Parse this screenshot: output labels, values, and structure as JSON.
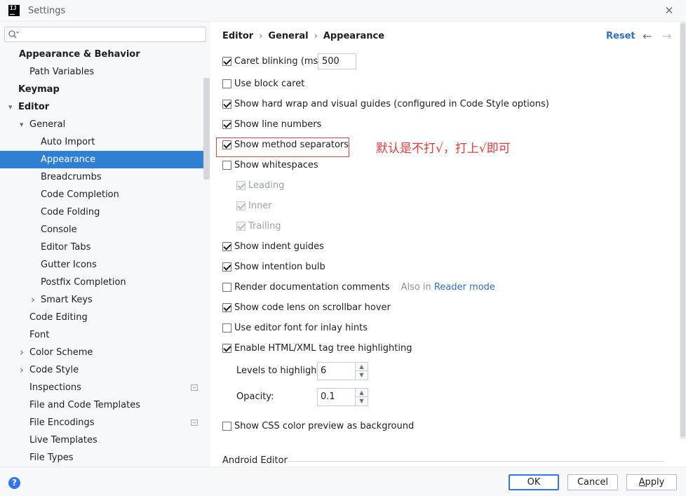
{
  "window": {
    "title": "Settings",
    "logo_text": "IJ"
  },
  "search": {
    "placeholder": "",
    "value": ""
  },
  "tree": [
    {
      "label": "Appearance & Behavior",
      "bold": true,
      "arrow": ""
    },
    {
      "label": "Path Variables",
      "bold": false,
      "arrow": ""
    },
    {
      "label": "Keymap",
      "bold": true,
      "arrow": ""
    },
    {
      "label": "Editor",
      "bold": true,
      "arrow": "▾"
    },
    {
      "label": "General",
      "bold": false,
      "arrow": "▾"
    },
    {
      "label": "Auto Import",
      "bold": false,
      "arrow": ""
    },
    {
      "label": "Appearance",
      "bold": false,
      "arrow": "",
      "selected": true
    },
    {
      "label": "Breadcrumbs",
      "bold": false,
      "arrow": ""
    },
    {
      "label": "Code Completion",
      "bold": false,
      "arrow": ""
    },
    {
      "label": "Code Folding",
      "bold": false,
      "arrow": ""
    },
    {
      "label": "Console",
      "bold": false,
      "arrow": ""
    },
    {
      "label": "Editor Tabs",
      "bold": false,
      "arrow": ""
    },
    {
      "label": "Gutter Icons",
      "bold": false,
      "arrow": ""
    },
    {
      "label": "Postfix Completion",
      "bold": false,
      "arrow": ""
    },
    {
      "label": "Smart Keys",
      "bold": false,
      "arrow": "›"
    },
    {
      "label": "Code Editing",
      "bold": false,
      "arrow": ""
    },
    {
      "label": "Font",
      "bold": false,
      "arrow": ""
    },
    {
      "label": "Color Scheme",
      "bold": false,
      "arrow": "›"
    },
    {
      "label": "Code Style",
      "bold": false,
      "arrow": "›"
    },
    {
      "label": "Inspections",
      "bold": false,
      "arrow": "",
      "extra": true
    },
    {
      "label": "File and Code Templates",
      "bold": false,
      "arrow": ""
    },
    {
      "label": "File Encodings",
      "bold": false,
      "arrow": "",
      "extra": true
    },
    {
      "label": "Live Templates",
      "bold": false,
      "arrow": ""
    },
    {
      "label": "File Types",
      "bold": false,
      "arrow": ""
    }
  ],
  "breadcrumb": {
    "part1": "Editor",
    "part2": "General",
    "part3": "Appearance",
    "sep": "›"
  },
  "header": {
    "reset": "Reset",
    "back": "←",
    "forward": "→"
  },
  "options": {
    "caret_blinking": {
      "label": "Caret blinking (ms):",
      "checked": true,
      "value": "500"
    },
    "block_caret": {
      "label": "Use block caret",
      "checked": false
    },
    "hard_wrap": {
      "label": "Show hard wrap and visual guides (configured in Code Style options)",
      "checked": true
    },
    "line_numbers": {
      "label": "Show line numbers",
      "checked": true
    },
    "method_separators": {
      "label": "Show method separators",
      "checked": true
    },
    "whitespaces": {
      "label": "Show whitespaces",
      "checked": false
    },
    "leading": {
      "label": "Leading",
      "checked": true,
      "disabled": true
    },
    "inner": {
      "label": "Inner",
      "checked": true,
      "disabled": true
    },
    "trailing": {
      "label": "Trailing",
      "checked": true,
      "disabled": true
    },
    "indent_guides": {
      "label": "Show indent guides",
      "checked": true
    },
    "intention_bulb": {
      "label": "Show intention bulb",
      "checked": true
    },
    "render_docs": {
      "label": "Render documentation comments",
      "checked": false,
      "also": "Also in",
      "link": "Reader mode"
    },
    "code_lens": {
      "label": "Show code lens on scrollbar hover",
      "checked": true
    },
    "inlay_font": {
      "label": "Use editor font for inlay hints",
      "checked": false
    },
    "tag_tree": {
      "label": "Enable HTML/XML tag tree highlighting",
      "checked": true
    },
    "levels": {
      "label": "Levels to highlight:",
      "value": "6"
    },
    "opacity": {
      "label": "Opacity:",
      "value": "0.1"
    },
    "css_preview": {
      "label": "Show CSS color preview as background",
      "checked": false
    }
  },
  "annotation": {
    "note": "默认是不打√，打上√即可",
    "color": "#e03c3c"
  },
  "section": {
    "android": "Android Editor"
  },
  "footer": {
    "help": "?",
    "ok": "OK",
    "cancel": "Cancel",
    "apply_pre": "",
    "apply_u": "A",
    "apply_post": "pply"
  },
  "colors": {
    "selection": "#2f7fd3",
    "link": "#2f6fc4",
    "focus": "#3574f0"
  }
}
